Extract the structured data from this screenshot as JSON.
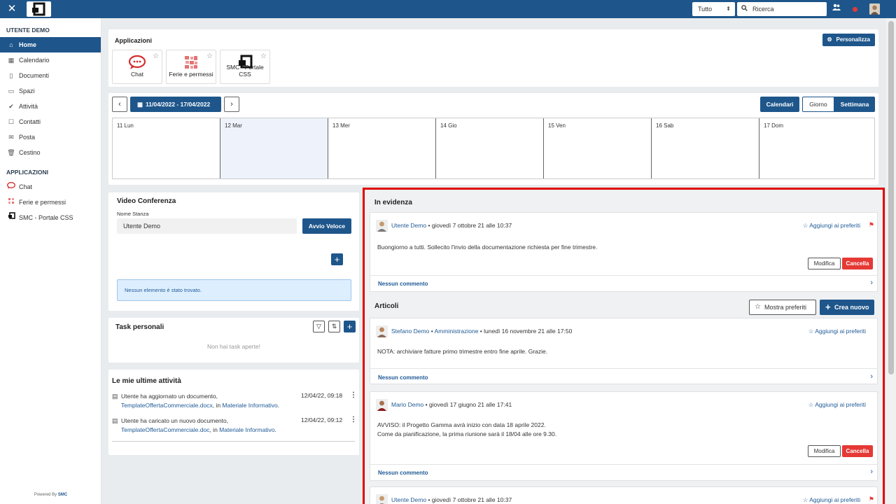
{
  "topbar": {
    "filter_selected": "Tutto",
    "search_placeholder": "Ricerca"
  },
  "sidebar": {
    "user_section": "UTENTE DEMO",
    "items": [
      {
        "label": "Home",
        "icon": "home-icon"
      },
      {
        "label": "Calendario",
        "icon": "calendar-icon"
      },
      {
        "label": "Documenti",
        "icon": "document-icon"
      },
      {
        "label": "Spazi",
        "icon": "monitor-icon"
      },
      {
        "label": "Attività",
        "icon": "check-icon"
      },
      {
        "label": "Contatti",
        "icon": "contacts-icon"
      },
      {
        "label": "Posta",
        "icon": "mail-icon"
      },
      {
        "label": "Cestino",
        "icon": "trash-icon"
      }
    ],
    "apps_section": "APPLICAZIONI",
    "apps": [
      {
        "label": "Chat"
      },
      {
        "label": "Ferie e permessi"
      },
      {
        "label": "SMC - Portale CSS"
      }
    ],
    "footer_prefix": "Powered By",
    "footer_brand": "SMC"
  },
  "apps": {
    "title": "Applicazioni",
    "customize_label": "Personalizza",
    "tiles": [
      {
        "label": "Chat"
      },
      {
        "label": "Ferie e permessi"
      },
      {
        "label": "SMC - Portale CSS"
      }
    ]
  },
  "calendar": {
    "range": "11/04/2022 - 17/04/2022",
    "calendars_label": "Calendari",
    "day_label": "Giorno",
    "week_label": "Settimana",
    "days": [
      "11 Lun",
      "12 Mar",
      "13 Mer",
      "14 Gio",
      "15 Ven",
      "16 Sab",
      "17 Dom"
    ]
  },
  "video": {
    "title": "Video Conferenza",
    "room_label": "Nome Stanza",
    "room_value": "Utente Demo",
    "quick_start_label": "Avvio Veloce",
    "empty_message": "Nessun elemento è stato trovato."
  },
  "tasks": {
    "title": "Task personali",
    "empty_message": "Non hai task aperte!"
  },
  "activities": {
    "title": "Le mie ultime attività",
    "items": [
      {
        "prefix": "Utente ha aggiornato un documento,",
        "file": "TemplateOffertaCommerciale.docx",
        "mid": ", in",
        "folder": "Materiale Informativo",
        "suffix": ".",
        "time": "12/04/22, 09:18"
      },
      {
        "prefix": "Utente ha caricato un nuovo documento,",
        "file": "TemplateOffertaCommerciale.doc",
        "mid": ", in",
        "folder": "Materiale Informativo",
        "suffix": ".",
        "time": "12/04/22, 09:12"
      }
    ]
  },
  "feed": {
    "highlight_title": "In evidenza",
    "articles_title": "Articoli",
    "show_favorites_label": "Mostra preferiti",
    "create_new_label": "Crea nuovo",
    "add_favorite_label": "Aggiungi ai preferiti",
    "edit_label": "Modifica",
    "delete_label": "Cancella",
    "no_comments_label": "Nessun commento",
    "highlight_post": {
      "author": "Utente Demo",
      "date": "giovedì 7 ottobre 21 alle 10:37",
      "body": "Buongiorno a tutti. Sollecito l'invio della documentazione richiesta per fine trimestre."
    },
    "articles": [
      {
        "author": "Stefano Demo",
        "group": "Amministrazione",
        "date": "lunedì 16 novembre 21 alle 17:50",
        "body": "NOTA: archiviare fatture primo trimestre entro fine aprile. Grazie."
      },
      {
        "author": "Mario Demo",
        "date": "giovedì 17 giugno 21 alle 17:41",
        "body1": "AVVISO: il Progetto Gamma avrà inizio con data 18 aprile 2022.",
        "body2": "Come da pianificazione, la prima riunione sarà il 18/04 alle ore 9.30."
      },
      {
        "author": "Utente Demo",
        "date": "giovedì 7 ottobre 21 alle 10:37"
      }
    ]
  },
  "colors": {
    "primary": "#1e568b",
    "danger": "#e53935",
    "highlight_border": "#e00000"
  }
}
